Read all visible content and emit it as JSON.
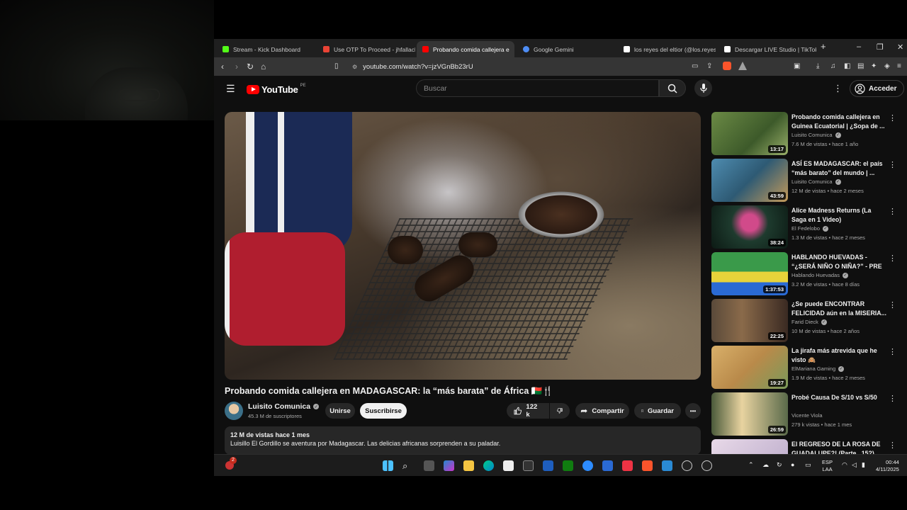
{
  "tabs": [
    {
      "label": "Stream - Kick Dashboard",
      "favicon_color": "#53fc18"
    },
    {
      "label": "Use OTP To Proceed - jhfallach@",
      "favicon_color": "#ea4335"
    },
    {
      "label": "Probando comida callejera e",
      "favicon_color": "#ff0000",
      "close": "✕"
    },
    {
      "label": "Google Gemini",
      "favicon_color": "#4e8df5"
    },
    {
      "label": "los reyes del eltior (@los.reyes.d",
      "favicon_color": "#ffffff"
    },
    {
      "label": "Descargar LIVE Studio | TikTok",
      "favicon_color": "#ffffff"
    }
  ],
  "new_tab": "+",
  "window_controls": {
    "minimize": "–",
    "maximize": "❐",
    "close": "✕"
  },
  "address_bar": {
    "url": "youtube.com/watch?v=jzVGnBb23rU"
  },
  "youtube": {
    "logo_text": "YouTube",
    "country": "PE",
    "search_placeholder": "Buscar",
    "signin_label": "Acceder"
  },
  "video": {
    "title": "Probando comida callejera en MADAGASCAR: la “más barata” de África 🇲🇬🍴",
    "channel": "Luisito Comunica",
    "subscribers": "45.3 M de suscriptores",
    "join_label": "Unirse",
    "subscribe_label": "Suscribirse",
    "likes": "122 k",
    "share_label": "Compartir",
    "save_label": "Guardar",
    "more": "•••",
    "views_time": "12 M de vistas  hace 1 mes",
    "description": "Luisillo El Gordillo se aventura por Madagascar. Las delicias africanas sorprenden a su paladar."
  },
  "recommendations": [
    {
      "title": "Probando comida callejera en Guinea Ecuatorial | ¿Sopa de ...",
      "channel": "Luisito Comunica",
      "meta": "7.6 M de vistas • hace 1 año",
      "duration": "13:17",
      "thumb_color": "#5a7a3a"
    },
    {
      "title": "ASÍ ES MADAGASCAR: el país “más barato” del mundo | ...",
      "channel": "Luisito Comunica",
      "meta": "12 M de vistas • hace 2 meses",
      "duration": "43:59",
      "thumb_color": "#3f7a9a"
    },
    {
      "title": "Alice Madness Returns (La Saga en 1 Video)",
      "channel": "El Fedelobo",
      "meta": "1.3 M de vistas • hace 2 meses",
      "duration": "38:24",
      "thumb_color": "#1e3b2e"
    },
    {
      "title": "HABLANDO HUEVADAS - “¿SERÁ NIÑO O NIÑA?” - PRE ...",
      "channel": "Hablando Huevadas",
      "meta": "3.2 M de vistas • hace 8 días",
      "duration": "1:37:53",
      "thumb_color": "#c9b43a"
    },
    {
      "title": "¿Se puede ENCONTRAR FELICIDAD aún en la MISERIA...",
      "channel": "Farid Dieck",
      "meta": "10 M de vistas • hace 2 años",
      "duration": "22:25",
      "thumb_color": "#6a4a3a"
    },
    {
      "title": "La jirafa más atrevida que he visto 🙈",
      "channel": "ElMariana Gaming",
      "meta": "1.9 M de vistas • hace 2 meses",
      "duration": "19:27",
      "thumb_color": "#b98a4a"
    },
    {
      "title": "Probé Causa De S/10 vs S/50",
      "channel": "Vicente Viola",
      "meta": "279 k vistas • hace 1 mes",
      "duration": "26:59",
      "thumb_color": "#7a8a5a"
    },
    {
      "title": "El REGRESO DE LA ROSA DE GUADALUPE?! (Parte...15?)",
      "channel": "",
      "meta": "",
      "duration": "",
      "thumb_color": "#d9c9d9"
    }
  ],
  "taskbar": {
    "lang": "ESP",
    "layout": "LAA",
    "time": "00:44",
    "date": "4/11/2025",
    "notification_count": "2"
  }
}
